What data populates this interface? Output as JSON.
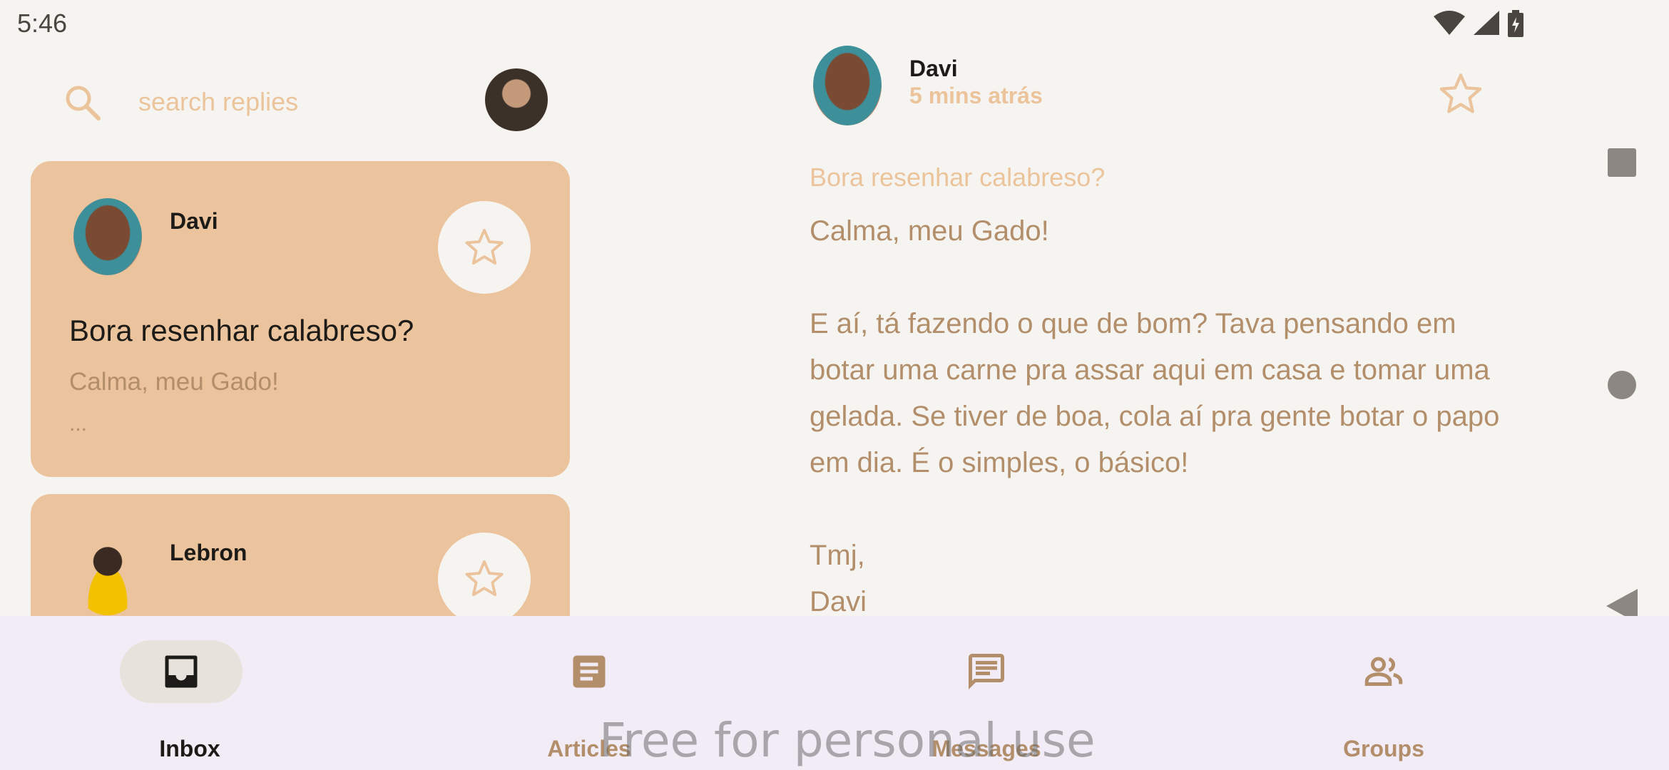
{
  "status_bar": {
    "time": "5:46",
    "icons": [
      "wifi-icon",
      "cell-signal-icon",
      "battery-charging-icon"
    ]
  },
  "search": {
    "placeholder": "search replies"
  },
  "emails": [
    {
      "sender": "Davi",
      "subject": "Bora resenhar calabreso?",
      "preview": "Calma, meu Gado!",
      "ellipsis": "...",
      "starred": false
    },
    {
      "sender": "Lebron",
      "starred": false
    }
  ],
  "detail": {
    "sender": "Davi",
    "time": "5 mins atrás",
    "subject": "Bora resenhar calabreso?",
    "greeting": "Calma, meu Gado!",
    "paragraph": "E aí, tá fazendo o que de bom? Tava pensando em botar uma carne pra assar aqui em casa e tomar uma gelada. Se tiver de boa, cola aí pra gente botar o papo em dia. É o simples, o básico!",
    "signoff": "Tmj,",
    "signature": "Davi"
  },
  "bottom_nav": {
    "items": [
      {
        "label": "Inbox",
        "icon": "inbox-icon",
        "selected": true
      },
      {
        "label": "Articles",
        "icon": "article-icon",
        "selected": false
      },
      {
        "label": "Messages",
        "icon": "chat-icon",
        "selected": false
      },
      {
        "label": "Groups",
        "icon": "groups-icon",
        "selected": false
      }
    ]
  },
  "watermark": "Free for personal use",
  "colors": {
    "accent": "#ebc39c",
    "accent_text": "#b28e6a",
    "light_accent": "#ecc49c",
    "background": "#f6f4f1",
    "nav_bg": "#f2ecf6"
  }
}
